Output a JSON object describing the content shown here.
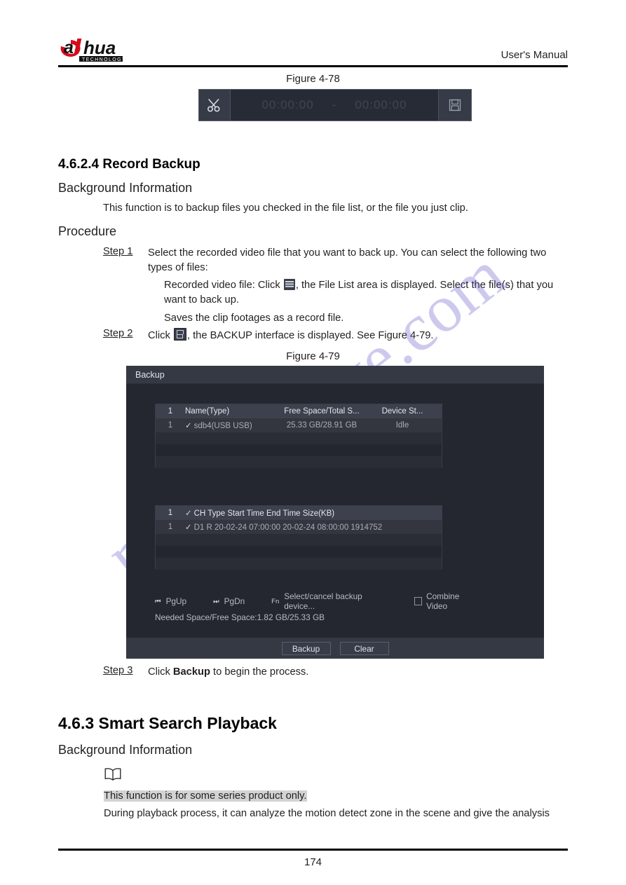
{
  "header": {
    "brand": "alhua",
    "brand_sub": "TECHNOLOGY",
    "title": "User's Manual"
  },
  "footer": {
    "page_number": "174"
  },
  "figure_78": {
    "caption": "Figure 4-78",
    "scissors_icon": "scissors-icon",
    "start_time": "00:00:00",
    "dash": "-",
    "end_time": "00:00:00",
    "save_icon": "save-icon"
  },
  "section_4624": {
    "heading": "4.6.2.4 Record Backup",
    "background_heading": "Background Information",
    "background_text": "This function is to backup files you checked in the file list, or the file you just clip.",
    "procedure_heading": "Procedure",
    "step1_label": "Step 1",
    "step1_line1": "Select the recorded video file that you want to back up. You can select the following two",
    "step1_line2": "types of files:",
    "step1_bullet1_pre": "Recorded video file: Click",
    "step1_bullet1_post": ", the File List area is displayed. Select the file(s) that you",
    "step1_bullet1_line2": "want to back up.",
    "step1_bullet2": "Saves the clip footages as a record file.",
    "step2_label": "Step 2",
    "step2_pre": "Click",
    "step2_post": ", the BACKUP interface is displayed. See Figure 4-79.",
    "step3_label": "Step 3",
    "step3_pre": "Click ",
    "step3_bold": "Backup",
    "step3_post": " to begin the process."
  },
  "figure_79": {
    "caption": "Figure 4-79",
    "title": "Backup",
    "device_table": {
      "headers": [
        "1",
        "Name(Type)",
        "Free Space/Total S...",
        "Device St..."
      ],
      "rows": [
        {
          "index": "1",
          "check": "✓",
          "name": "sdb4(USB USB)",
          "free_total": "25.33 GB/28.91 GB",
          "status": "Idle"
        }
      ]
    },
    "file_table": {
      "header_index": "1",
      "header_check": "✓",
      "header_rest": "CH Type Start Time End Time Size(KB)",
      "rows": [
        {
          "index": "1",
          "check": "✓",
          "rest": "D1   R    20-02-24 07:00:00    20-02-24 08:00:00  1914752"
        }
      ]
    },
    "controls": {
      "pgup_key": "⏮",
      "pgup_label": "PgUp",
      "pgdn_key": "⏭",
      "pgdn_label": "PgDn",
      "fn_key": "Fn",
      "fn_label": "Select/cancel backup device...",
      "combine_label": "Combine Video"
    },
    "space_info": "Needed Space/Free Space:1.82 GB/25.33 GB",
    "buttons": {
      "backup": "Backup",
      "clear": "Clear"
    }
  },
  "section_463": {
    "heading": "4.6.3 Smart Search Playback",
    "background_heading": "Background Information",
    "note_icon": "book-note-icon",
    "note_text": "This function is for some series product only.",
    "body_text": "During playback process, it can analyze the motion detect zone in the scene and give the analysis"
  },
  "watermark": {
    "text": "manualshive.com"
  }
}
